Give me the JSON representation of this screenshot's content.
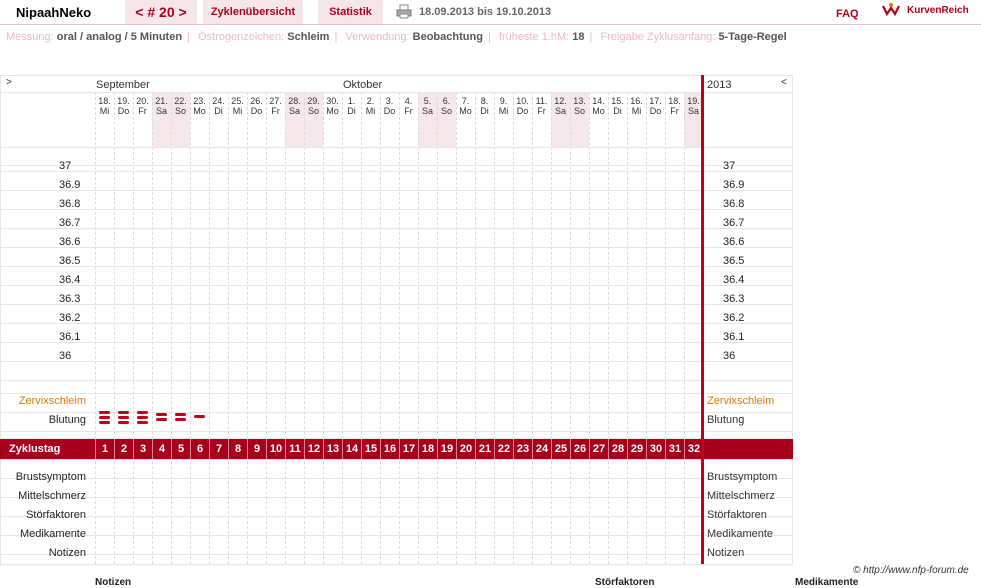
{
  "header": {
    "username": "NipaahNeko",
    "cycle_nav": "< # 20 >",
    "tab_overview": "Zyklenübersicht",
    "tab_stats": "Statistik",
    "date_range": "18.09.2013 bis 19.10.2013",
    "faq": "FAQ",
    "brand": "KurvenReich"
  },
  "settings": {
    "measure_label": "Messung:",
    "measure_value": "oral / analog / 5 Minuten",
    "estrogen_label": "Östrogenzeichen:",
    "estrogen_value": "Schleim",
    "usage_label": "Verwendung:",
    "usage_value": "Beobachtung",
    "earliest_label": "früheste 1.hM:",
    "earliest_value": "18",
    "release_label": "Freigabe Zyklusanfang:",
    "release_value": "5-Tage-Regel"
  },
  "chart": {
    "nav_left": ">",
    "nav_right": "<",
    "month_sep": "September",
    "month_oct": "Oktober",
    "year": "2013",
    "days": [
      {
        "d": "18.",
        "w": "Mi",
        "we": false
      },
      {
        "d": "19.",
        "w": "Do",
        "we": false
      },
      {
        "d": "20.",
        "w": "Fr",
        "we": false
      },
      {
        "d": "21.",
        "w": "Sa",
        "we": true
      },
      {
        "d": "22.",
        "w": "So",
        "we": true
      },
      {
        "d": "23.",
        "w": "Mo",
        "we": false
      },
      {
        "d": "24.",
        "w": "Di",
        "we": false
      },
      {
        "d": "25.",
        "w": "Mi",
        "we": false
      },
      {
        "d": "26.",
        "w": "Do",
        "we": false
      },
      {
        "d": "27.",
        "w": "Fr",
        "we": false
      },
      {
        "d": "28.",
        "w": "Sa",
        "we": true
      },
      {
        "d": "29.",
        "w": "So",
        "we": true
      },
      {
        "d": "30.",
        "w": "Mo",
        "we": false
      },
      {
        "d": "1.",
        "w": "Di",
        "we": false
      },
      {
        "d": "2.",
        "w": "Mi",
        "we": false
      },
      {
        "d": "3.",
        "w": "Do",
        "we": false
      },
      {
        "d": "4.",
        "w": "Fr",
        "we": false
      },
      {
        "d": "5.",
        "w": "Sa",
        "we": true
      },
      {
        "d": "6.",
        "w": "So",
        "we": true
      },
      {
        "d": "7.",
        "w": "Mo",
        "we": false
      },
      {
        "d": "8.",
        "w": "Di",
        "we": false
      },
      {
        "d": "9.",
        "w": "Mi",
        "we": false
      },
      {
        "d": "10.",
        "w": "Do",
        "we": false
      },
      {
        "d": "11.",
        "w": "Fr",
        "we": false
      },
      {
        "d": "12.",
        "w": "Sa",
        "we": true
      },
      {
        "d": "13.",
        "w": "So",
        "we": true
      },
      {
        "d": "14.",
        "w": "Mo",
        "we": false
      },
      {
        "d": "15.",
        "w": "Di",
        "we": false
      },
      {
        "d": "16.",
        "w": "Mi",
        "we": false
      },
      {
        "d": "17.",
        "w": "Do",
        "we": false
      },
      {
        "d": "18.",
        "w": "Fr",
        "we": false
      },
      {
        "d": "19.",
        "w": "Sa",
        "we": true
      }
    ],
    "temps": [
      "37",
      "36.9",
      "36.8",
      "36.7",
      "36.6",
      "36.5",
      "36.4",
      "36.3",
      "36.2",
      "36.1",
      "36"
    ],
    "cervix_label": "Zervixschleim",
    "bleeding_label": "Blutung",
    "bleeding": [
      {
        "day": 1,
        "level": "heavy"
      },
      {
        "day": 2,
        "level": "heavy"
      },
      {
        "day": 3,
        "level": "heavy"
      },
      {
        "day": 4,
        "level": "medium"
      },
      {
        "day": 5,
        "level": "medium"
      },
      {
        "day": 6,
        "level": "spotting"
      }
    ],
    "cycle_day_label": "Zyklustag",
    "cycle_days": [
      "1",
      "2",
      "3",
      "4",
      "5",
      "6",
      "7",
      "8",
      "9",
      "10",
      "11",
      "12",
      "13",
      "14",
      "15",
      "16",
      "17",
      "18",
      "19",
      "20",
      "21",
      "22",
      "23",
      "24",
      "25",
      "26",
      "27",
      "28",
      "29",
      "30",
      "31",
      "32"
    ],
    "bottom_rows": [
      "Brustsymptom",
      "Mittelschmerz",
      "Störfaktoren",
      "Medikamente",
      "Notizen"
    ]
  },
  "footer": {
    "copyright": "© http://www.nfp-forum.de",
    "col1": "Notizen",
    "col2": "Störfaktoren",
    "col3": "Medikamente"
  },
  "colors": {
    "accent": "#b00020",
    "cycle_bar": "#a8001c",
    "weekend": "#f6e8ea",
    "cervix": "#e07800"
  }
}
